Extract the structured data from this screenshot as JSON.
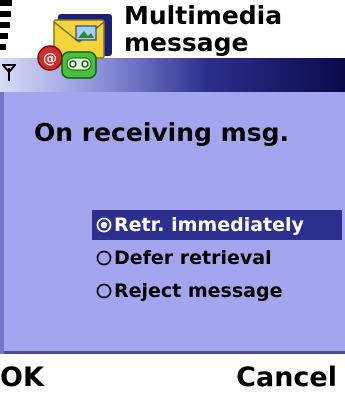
{
  "header": {
    "title_line1": "Multimedia",
    "title_line2": "message",
    "app_icon": "multimedia-message-icon",
    "status_icons": [
      "signal-strength-icon",
      "antenna-icon"
    ]
  },
  "panel": {
    "setting_label": "On receiving msg."
  },
  "options": [
    {
      "label": "Retr. immediately",
      "selected": true
    },
    {
      "label": "Defer retrieval",
      "selected": false
    },
    {
      "label": "Reject message",
      "selected": false
    }
  ],
  "softkeys": {
    "left": "OK",
    "right": "Cancel"
  },
  "colors": {
    "panel_background": "#a3a6ee",
    "selection_highlight": "#2c2f8e",
    "header_gradient_dark": "#0a0a4a"
  }
}
